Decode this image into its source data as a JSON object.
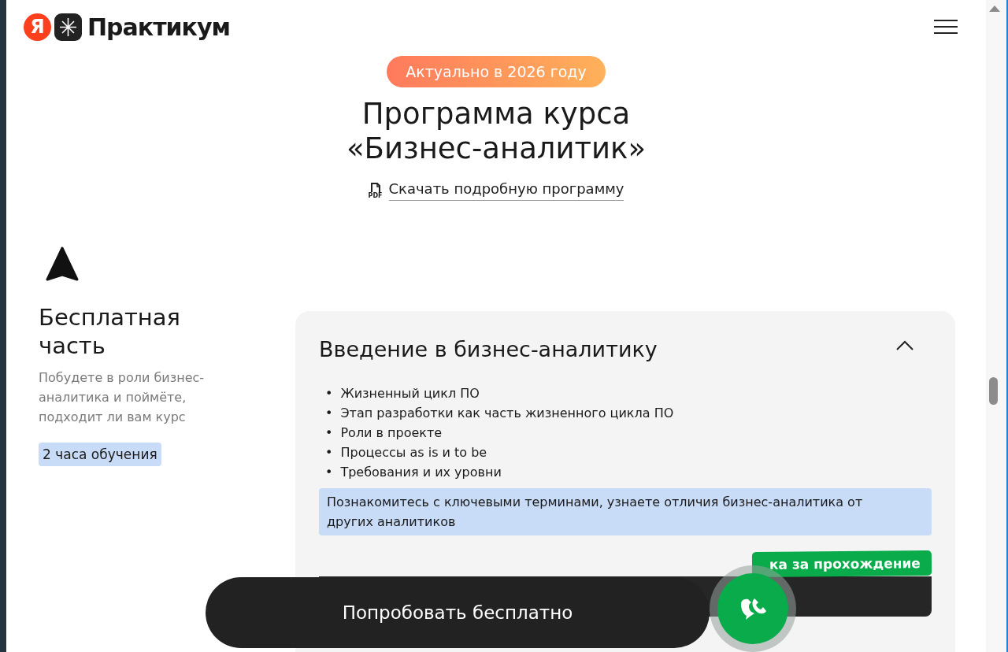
{
  "header": {
    "logo_letter": "Я",
    "logo_text": "Практикум"
  },
  "hero": {
    "badge": "Актуально в 2026 году",
    "title_lines": [
      "Программа курса",
      "«Бизнес-аналитик»"
    ],
    "download_link": "Скачать подробную программу",
    "pdf_label": "PDF"
  },
  "section": {
    "title": "Бесплатная часть",
    "description": "Побудете в роли бизнес-аналитика и поймёте, подходит ли вам курс",
    "duration": "2 часа обучения"
  },
  "module": {
    "title": "Введение в бизнес-аналитику",
    "expanded": true,
    "bullet": "•",
    "topics": [
      "Жизненный цикл ПО",
      "Этап разработки как часть жизненного цикла ПО",
      "Роли в проекте",
      "Процессы as is и to be",
      "Требования и их уровни"
    ],
    "note": "Познакомитесь с ключевыми терминами, узнаете отличия бизнес-аналитика от других аналитиков",
    "reward_tag": "ка за прохождение"
  },
  "cta_button": "Попробовать бесплатно"
}
